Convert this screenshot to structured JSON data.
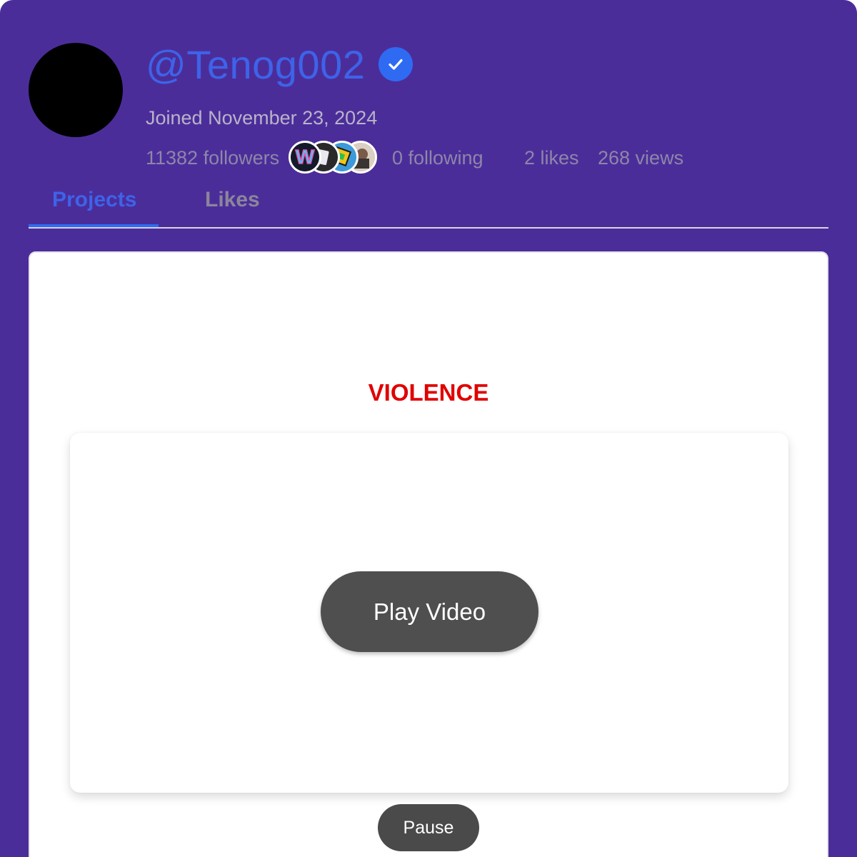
{
  "profile": {
    "username": "@Tenog002",
    "verified_icon": "verified-check-icon",
    "joined": "Joined November 23, 2024",
    "stats": {
      "followers": "11382 followers",
      "following": "0 following",
      "likes": "2 likes",
      "views": "268 views"
    },
    "follower_avatars": [
      "follower-avatar-w-icon",
      "follower-avatar-dark-icon",
      "follower-avatar-dash-icon",
      "follower-avatar-photo-icon"
    ]
  },
  "tabs": [
    {
      "label": "Projects",
      "active": true
    },
    {
      "label": "Likes",
      "active": false
    }
  ],
  "project": {
    "warning": "VIOLENCE",
    "play_label": "Play Video",
    "pause_label": "Pause"
  },
  "colors": {
    "background": "#4b2d9a",
    "accent": "#3d63e8",
    "warning": "#e00000",
    "button": "#4f4f4f"
  }
}
